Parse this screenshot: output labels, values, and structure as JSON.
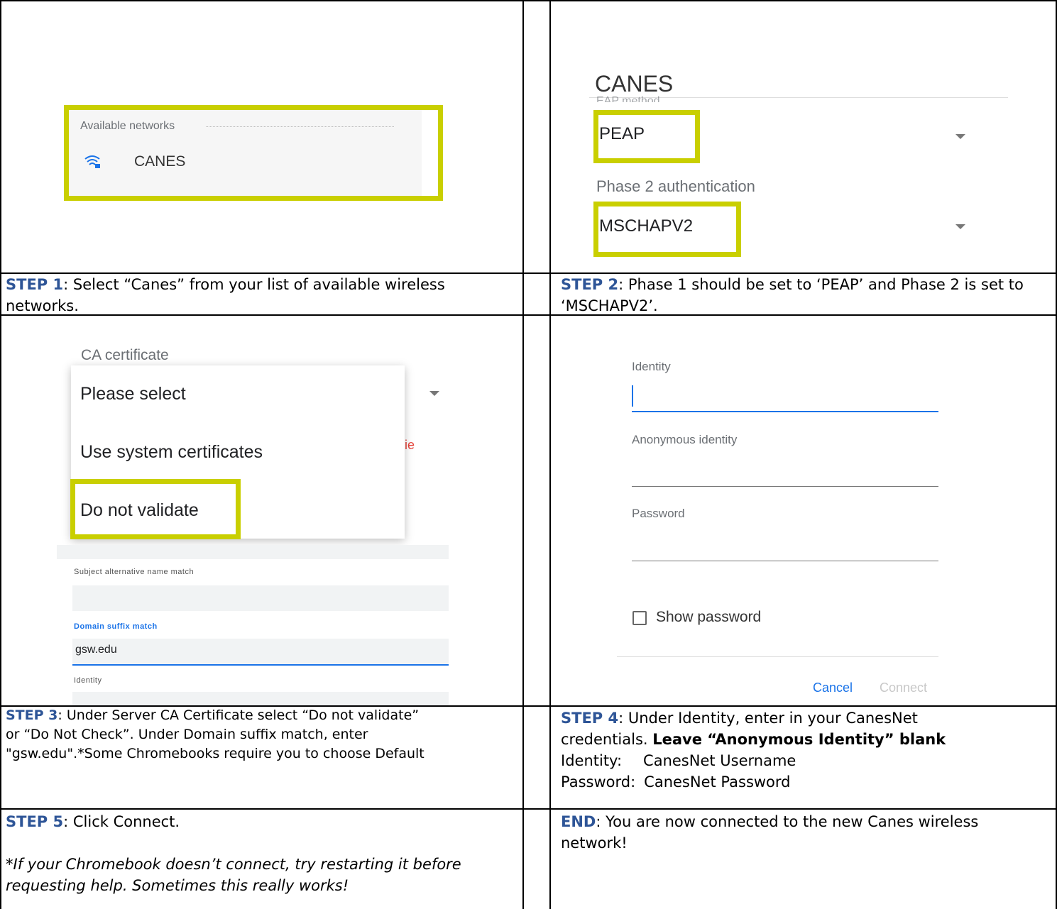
{
  "panel1": {
    "heading": "Available networks",
    "network": "CANES"
  },
  "panel2": {
    "title": "CANES",
    "field_cut": "EAP method",
    "eap_value": "PEAP",
    "phase2_label": "Phase 2 authentication",
    "phase2_value": "MSCHAPV2"
  },
  "panel3": {
    "ca_label": "CA certificate",
    "options": [
      "Please select",
      "Use system certificates",
      "Do not validate"
    ],
    "red_fragment": "ie",
    "san_label": "Subject alternative name match",
    "domain_label": "Domain suffix match",
    "domain_value": "gsw.edu",
    "identity_label": "Identity"
  },
  "panel4": {
    "identity_label": "Identity",
    "anon_label": "Anonymous identity",
    "password_label": "Password",
    "show_password": "Show password",
    "cancel": "Cancel",
    "connect": "Connect"
  },
  "captions": {
    "step1_label": "STEP 1",
    "step1_text": ": Select “Canes” from your list of available wireless networks.",
    "step2_label": "STEP 2",
    "step2_text": ": Phase 1 should be set to ‘PEAP’ and Phase 2 is set to ‘MSCHAPV2’.",
    "step3_label": "STEP 3",
    "step3_text": ": Under Server CA Certificate select “Do not validate” or “Do Not Check”. Under Domain suffix match, enter \"gsw.edu\".*Some Chromebooks require you to choose Default",
    "step4_label": "STEP 4",
    "step4_text": ": Under Identity, enter in your CanesNet credentials. ",
    "step4_bold": "Leave “Anonymous Identity” blank",
    "step4_id_label": "Identity:",
    "step4_id_value": "CanesNet Username",
    "step4_pw_label": "Password:",
    "step4_pw_value": "CanesNet Password",
    "step5_label": "STEP 5",
    "step5_text": ": Click Connect.",
    "step5_note": "*If your Chromebook doesn’t connect, try restarting it before requesting help. Sometimes this really works!",
    "end_label": "END",
    "end_text": ": You are now connected to the new Canes wireless network!"
  },
  "colors": {
    "highlight": "#c9cf00",
    "step": "#2e5597",
    "link": "#1a73e8"
  }
}
